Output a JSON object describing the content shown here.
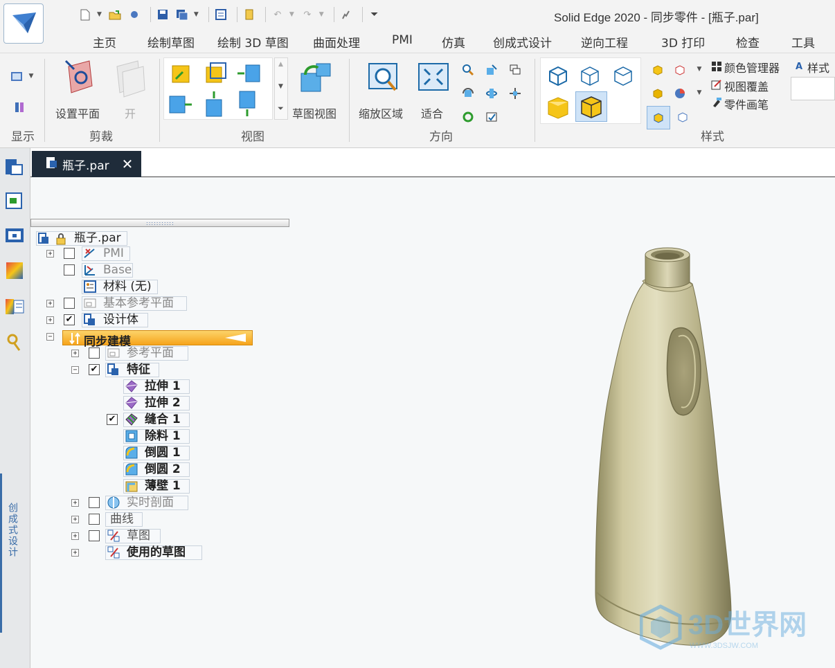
{
  "window": {
    "title": "Solid Edge 2020 - 同步零件 - [瓶子.par]"
  },
  "menu_tabs": [
    "主页",
    "绘制草图",
    "绘制 3D 草图",
    "曲面处理",
    "PMI",
    "仿真",
    "创成式设计",
    "逆向工程",
    "3D 打印",
    "检查",
    "工具"
  ],
  "ribbon": {
    "groups": {
      "display": "显示",
      "clip": "剪裁",
      "view": "视图",
      "orient": "方向",
      "style": "样式"
    },
    "set_plane": "设置平面",
    "open": "开",
    "sketch_view": "草图视图",
    "zoom_area": "缩放区域",
    "fit": "适合",
    "color_manager": "颜色管理器",
    "view_overlay": "视图覆盖",
    "part_painter": "零件画笔",
    "styles": "样式"
  },
  "dock": {
    "vertical_label": "创成式设计"
  },
  "document_tab": {
    "label": "瓶子.par",
    "close": "✕"
  },
  "tree": {
    "root": "瓶子.par",
    "pmi": "PMI",
    "base": "Base",
    "material": "材料 (无)",
    "base_ref_planes": "基本参考平面",
    "design_body": "设计体",
    "sync_modeling": "同步建模",
    "ref_planes": "参考平面",
    "features": "特征",
    "extrude1": "拉伸 1",
    "extrude2": "拉伸 2",
    "stitch1": "缝合 1",
    "cut1": "除料 1",
    "round1": "倒圆 1",
    "round2": "倒圆 2",
    "thinwall1": "薄壁 1",
    "live_section": "实时剖面",
    "curves": "曲线",
    "sketches": "草图",
    "used_sketches": "使用的草图"
  },
  "watermark": {
    "text": "3D世界网",
    "sub": "WWW.3DSJW.COM"
  },
  "colors": {
    "accent": "#f6a41b",
    "doc_tab": "#1f2c3a",
    "bottle": "#c9c29a"
  }
}
